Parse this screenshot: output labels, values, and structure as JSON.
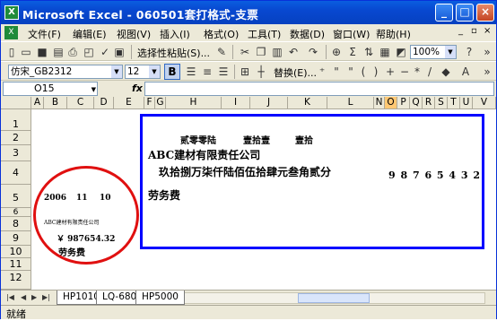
{
  "window": {
    "title": "Microsoft Excel - 060501套打格式-支票",
    "buttons": [
      "_",
      "□",
      "×"
    ]
  },
  "menu": {
    "items": [
      "文件(F)",
      "编辑(E)",
      "视图(V)",
      "插入(I)",
      "格式(O)",
      "工具(T)",
      "数据(D)",
      "窗口(W)",
      "帮助(H)"
    ],
    "right_controls": [
      "_",
      "▫",
      "×"
    ]
  },
  "toolbar1": {
    "paste_special_label": "选择性粘贴(S)...",
    "zoom": "100%",
    "help_icon": "?"
  },
  "toolbar2": {
    "font_name": "仿宋_GB2312",
    "font_size": "12",
    "bold": "B",
    "replace_label": "替换(E)...",
    "underline": "U",
    "italic": "I"
  },
  "formula_bar": {
    "cell_ref": "O15",
    "fx": "fx",
    "value": ""
  },
  "grid": {
    "columns": [
      "A",
      "B",
      "C",
      "D",
      "E",
      "F",
      "G",
      "H",
      "I",
      "J",
      "K",
      "L",
      "N",
      "O",
      "P",
      "Q",
      "R",
      "S",
      "T",
      "U",
      "V"
    ],
    "selected_column": "O",
    "rows": [
      "1",
      "2",
      "3",
      "4",
      "5",
      "6",
      "8",
      "9",
      "10",
      "11",
      "12"
    ],
    "cells": {
      "amount_upper_small": "贰零零陆",
      "month_upper": "壹拾壹",
      "day_upper": "壹拾",
      "payee": "ABC建材有限责任公司",
      "amount_words": "玖拾捌万柒仟陆佰伍拾肆元叁角贰分",
      "amount_digits": "9 8 7 6 5 4 3 2",
      "purpose": "劳务费",
      "stub_date_year": "2006",
      "stub_date_month": "11",
      "stub_date_day": "10",
      "stub_payee": "ABC建材有限责任公司",
      "stub_amount": "￥ 987654.32",
      "stub_purpose": "劳务费"
    }
  },
  "sheet_tabs": {
    "tabs": [
      "HP1010",
      "LQ-680",
      "HP5000"
    ],
    "active": "HP5000"
  },
  "status": {
    "text": "就绪"
  },
  "colors": {
    "frame": "#0000ff",
    "ellipse": "#e01010",
    "title_bar": "#0a5ee0"
  }
}
